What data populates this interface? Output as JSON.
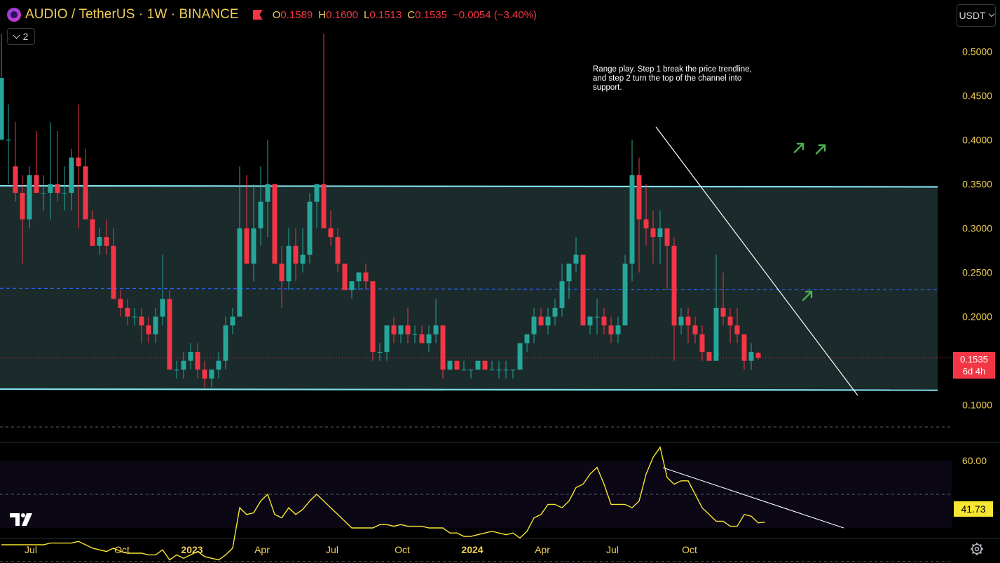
{
  "header": {
    "symbol": "AUDIO / TetherUS · 1W · BINANCE",
    "open_label": "O",
    "open": "0.1589",
    "high_label": "H",
    "high": "0.1600",
    "low_label": "L",
    "low": "0.1513",
    "close_label": "C",
    "close": "0.1535",
    "change": "−0.0054 (−3.40%)",
    "collapsed_count": "2",
    "currency": "USDT"
  },
  "annotation": "Range play. Step 1 break the price trendline, and step 2 turn the top of the channel into support.",
  "price_tag": {
    "price": "0.1535",
    "countdown": "6d 4h"
  },
  "rsi_tag": "41.73",
  "colors": {
    "up": "#26a69a",
    "down": "#f23645",
    "channel_line": "#80deea",
    "channel_fill": "#1b2a2b",
    "mid_line": "#2962ff",
    "trendline": "#ffffff",
    "rsi_line": "#f7e632",
    "arrow": "#4caf50",
    "label_yellow": "#f0cf57"
  },
  "icons": [
    "tradingview-logo-icon",
    "settings-gear-icon",
    "chevron-down-icon",
    "flag-icon",
    "arrow-up-right-icon"
  ],
  "chart_data": [
    {
      "type": "candlestick",
      "y_ticks": [
        "0.5000",
        "0.4500",
        "0.4000",
        "0.3500",
        "0.3000",
        "0.2500",
        "0.2000",
        "0.1000"
      ],
      "ylim": [
        0.08,
        0.54
      ],
      "x_ticks": [
        "Jul",
        "Oct",
        "2023",
        "Apr",
        "Jul",
        "Oct",
        "2024",
        "Apr",
        "Jul",
        "Oct"
      ],
      "x_tick_index": [
        4,
        17,
        27,
        37,
        47,
        57,
        67,
        77,
        87,
        98
      ],
      "candles": [
        [
          0.4,
          0.52,
          0.4,
          0.47
        ],
        [
          0.4,
          0.44,
          0.35,
          0.4
        ],
        [
          0.37,
          0.42,
          0.33,
          0.34
        ],
        [
          0.34,
          0.36,
          0.26,
          0.31
        ],
        [
          0.31,
          0.37,
          0.3,
          0.36
        ],
        [
          0.36,
          0.41,
          0.34,
          0.34
        ],
        [
          0.34,
          0.36,
          0.32,
          0.34
        ],
        [
          0.34,
          0.42,
          0.31,
          0.35
        ],
        [
          0.35,
          0.41,
          0.33,
          0.34
        ],
        [
          0.34,
          0.37,
          0.32,
          0.34
        ],
        [
          0.34,
          0.39,
          0.32,
          0.38
        ],
        [
          0.38,
          0.44,
          0.3,
          0.37
        ],
        [
          0.37,
          0.39,
          0.31,
          0.31
        ],
        [
          0.31,
          0.32,
          0.28,
          0.28
        ],
        [
          0.28,
          0.3,
          0.27,
          0.29
        ],
        [
          0.29,
          0.31,
          0.27,
          0.28
        ],
        [
          0.28,
          0.3,
          0.22,
          0.22
        ],
        [
          0.22,
          0.23,
          0.2,
          0.21
        ],
        [
          0.21,
          0.22,
          0.19,
          0.2
        ],
        [
          0.2,
          0.21,
          0.19,
          0.2
        ],
        [
          0.2,
          0.21,
          0.17,
          0.19
        ],
        [
          0.19,
          0.2,
          0.17,
          0.18
        ],
        [
          0.18,
          0.21,
          0.17,
          0.2
        ],
        [
          0.2,
          0.27,
          0.19,
          0.22
        ],
        [
          0.22,
          0.23,
          0.14,
          0.14
        ],
        [
          0.14,
          0.15,
          0.13,
          0.14
        ],
        [
          0.14,
          0.16,
          0.13,
          0.15
        ],
        [
          0.15,
          0.17,
          0.14,
          0.16
        ],
        [
          0.16,
          0.17,
          0.13,
          0.14
        ],
        [
          0.14,
          0.15,
          0.12,
          0.13
        ],
        [
          0.13,
          0.14,
          0.12,
          0.14
        ],
        [
          0.14,
          0.16,
          0.13,
          0.15
        ],
        [
          0.15,
          0.2,
          0.14,
          0.19
        ],
        [
          0.19,
          0.21,
          0.18,
          0.2
        ],
        [
          0.2,
          0.37,
          0.2,
          0.3
        ],
        [
          0.3,
          0.36,
          0.27,
          0.26
        ],
        [
          0.26,
          0.35,
          0.24,
          0.3
        ],
        [
          0.3,
          0.37,
          0.28,
          0.33
        ],
        [
          0.33,
          0.4,
          0.29,
          0.35
        ],
        [
          0.35,
          0.35,
          0.26,
          0.26
        ],
        [
          0.26,
          0.28,
          0.21,
          0.24
        ],
        [
          0.24,
          0.3,
          0.23,
          0.28
        ],
        [
          0.28,
          0.3,
          0.24,
          0.26
        ],
        [
          0.26,
          0.3,
          0.25,
          0.27
        ],
        [
          0.27,
          0.34,
          0.26,
          0.33
        ],
        [
          0.33,
          0.35,
          0.3,
          0.35
        ],
        [
          0.35,
          0.52,
          0.3,
          0.3
        ],
        [
          0.3,
          0.32,
          0.28,
          0.29
        ],
        [
          0.29,
          0.3,
          0.25,
          0.26
        ],
        [
          0.26,
          0.26,
          0.23,
          0.23
        ],
        [
          0.23,
          0.24,
          0.22,
          0.24
        ],
        [
          0.24,
          0.25,
          0.23,
          0.25
        ],
        [
          0.25,
          0.26,
          0.23,
          0.24
        ],
        [
          0.24,
          0.24,
          0.15,
          0.16
        ],
        [
          0.16,
          0.17,
          0.15,
          0.16
        ],
        [
          0.16,
          0.19,
          0.15,
          0.19
        ],
        [
          0.19,
          0.2,
          0.17,
          0.18
        ],
        [
          0.18,
          0.19,
          0.17,
          0.19
        ],
        [
          0.19,
          0.21,
          0.17,
          0.18
        ],
        [
          0.18,
          0.19,
          0.17,
          0.18
        ],
        [
          0.18,
          0.19,
          0.17,
          0.17
        ],
        [
          0.17,
          0.19,
          0.16,
          0.18
        ],
        [
          0.18,
          0.22,
          0.17,
          0.19
        ],
        [
          0.19,
          0.19,
          0.13,
          0.14
        ],
        [
          0.14,
          0.15,
          0.14,
          0.15
        ],
        [
          0.15,
          0.15,
          0.14,
          0.14
        ],
        [
          0.14,
          0.15,
          0.14,
          0.14
        ],
        [
          0.14,
          0.14,
          0.13,
          0.14
        ],
        [
          0.14,
          0.15,
          0.14,
          0.15
        ],
        [
          0.15,
          0.15,
          0.14,
          0.14
        ],
        [
          0.14,
          0.15,
          0.14,
          0.14
        ],
        [
          0.14,
          0.15,
          0.13,
          0.14
        ],
        [
          0.14,
          0.15,
          0.13,
          0.14
        ],
        [
          0.14,
          0.14,
          0.13,
          0.14
        ],
        [
          0.14,
          0.17,
          0.14,
          0.17
        ],
        [
          0.17,
          0.18,
          0.16,
          0.18
        ],
        [
          0.18,
          0.21,
          0.17,
          0.2
        ],
        [
          0.2,
          0.21,
          0.19,
          0.19
        ],
        [
          0.19,
          0.21,
          0.18,
          0.2
        ],
        [
          0.2,
          0.22,
          0.19,
          0.21
        ],
        [
          0.21,
          0.26,
          0.2,
          0.24
        ],
        [
          0.24,
          0.26,
          0.22,
          0.26
        ],
        [
          0.26,
          0.29,
          0.25,
          0.27
        ],
        [
          0.27,
          0.27,
          0.19,
          0.19
        ],
        [
          0.19,
          0.2,
          0.18,
          0.2
        ],
        [
          0.2,
          0.22,
          0.18,
          0.2
        ],
        [
          0.2,
          0.21,
          0.18,
          0.19
        ],
        [
          0.19,
          0.2,
          0.17,
          0.18
        ],
        [
          0.18,
          0.2,
          0.17,
          0.19
        ],
        [
          0.19,
          0.27,
          0.19,
          0.26
        ],
        [
          0.26,
          0.4,
          0.24,
          0.36
        ],
        [
          0.36,
          0.38,
          0.25,
          0.31
        ],
        [
          0.31,
          0.35,
          0.28,
          0.3
        ],
        [
          0.3,
          0.32,
          0.26,
          0.29
        ],
        [
          0.29,
          0.32,
          0.26,
          0.3
        ],
        [
          0.3,
          0.3,
          0.23,
          0.28
        ],
        [
          0.28,
          0.29,
          0.15,
          0.19
        ],
        [
          0.19,
          0.21,
          0.18,
          0.2
        ],
        [
          0.2,
          0.21,
          0.17,
          0.19
        ],
        [
          0.19,
          0.2,
          0.17,
          0.18
        ],
        [
          0.18,
          0.19,
          0.15,
          0.16
        ],
        [
          0.16,
          0.16,
          0.15,
          0.15
        ],
        [
          0.15,
          0.27,
          0.15,
          0.21
        ],
        [
          0.21,
          0.25,
          0.19,
          0.2
        ],
        [
          0.2,
          0.21,
          0.17,
          0.19
        ],
        [
          0.19,
          0.21,
          0.17,
          0.18
        ],
        [
          0.18,
          0.18,
          0.14,
          0.15
        ],
        [
          0.15,
          0.17,
          0.14,
          0.16
        ],
        [
          0.1589,
          0.16,
          0.1513,
          0.1535
        ]
      ],
      "channel": {
        "top": 0.348,
        "bottom": 0.118
      },
      "mid_line": 0.232,
      "current_price": 0.1535
    },
    {
      "type": "line",
      "name": "RSI",
      "y_ticks": [
        "60.00"
      ],
      "levels": [
        70,
        50,
        30
      ],
      "ylim": [
        25,
        80
      ],
      "values": [
        35,
        35,
        35,
        35,
        35,
        35,
        35,
        35.5,
        35.5,
        35.5,
        35.5,
        36,
        35,
        34,
        33.5,
        33,
        34,
        33,
        32.5,
        32.5,
        32.5,
        32,
        32,
        33.5,
        30.5,
        32,
        31,
        32,
        33,
        31.5,
        31,
        30.5,
        32,
        34,
        46,
        44,
        44.5,
        48,
        50,
        44,
        43,
        46,
        44,
        45.5,
        48,
        50,
        48,
        46,
        44,
        42,
        40,
        40,
        40,
        40,
        41,
        41,
        40.5,
        41,
        40.5,
        40.5,
        40.5,
        40,
        40,
        40,
        38.5,
        38.5,
        37.5,
        37.5,
        38,
        38.5,
        39,
        38.5,
        38,
        38.5,
        37,
        39,
        43,
        44,
        47,
        47,
        46,
        48,
        52,
        53,
        56,
        58,
        53,
        47,
        47,
        47,
        46,
        48,
        56,
        61,
        64,
        55,
        53,
        54,
        54,
        50,
        46,
        44,
        42,
        42,
        40.5,
        40.5,
        44,
        43.5,
        41.5,
        41.73
      ],
      "value": "41.73"
    }
  ]
}
